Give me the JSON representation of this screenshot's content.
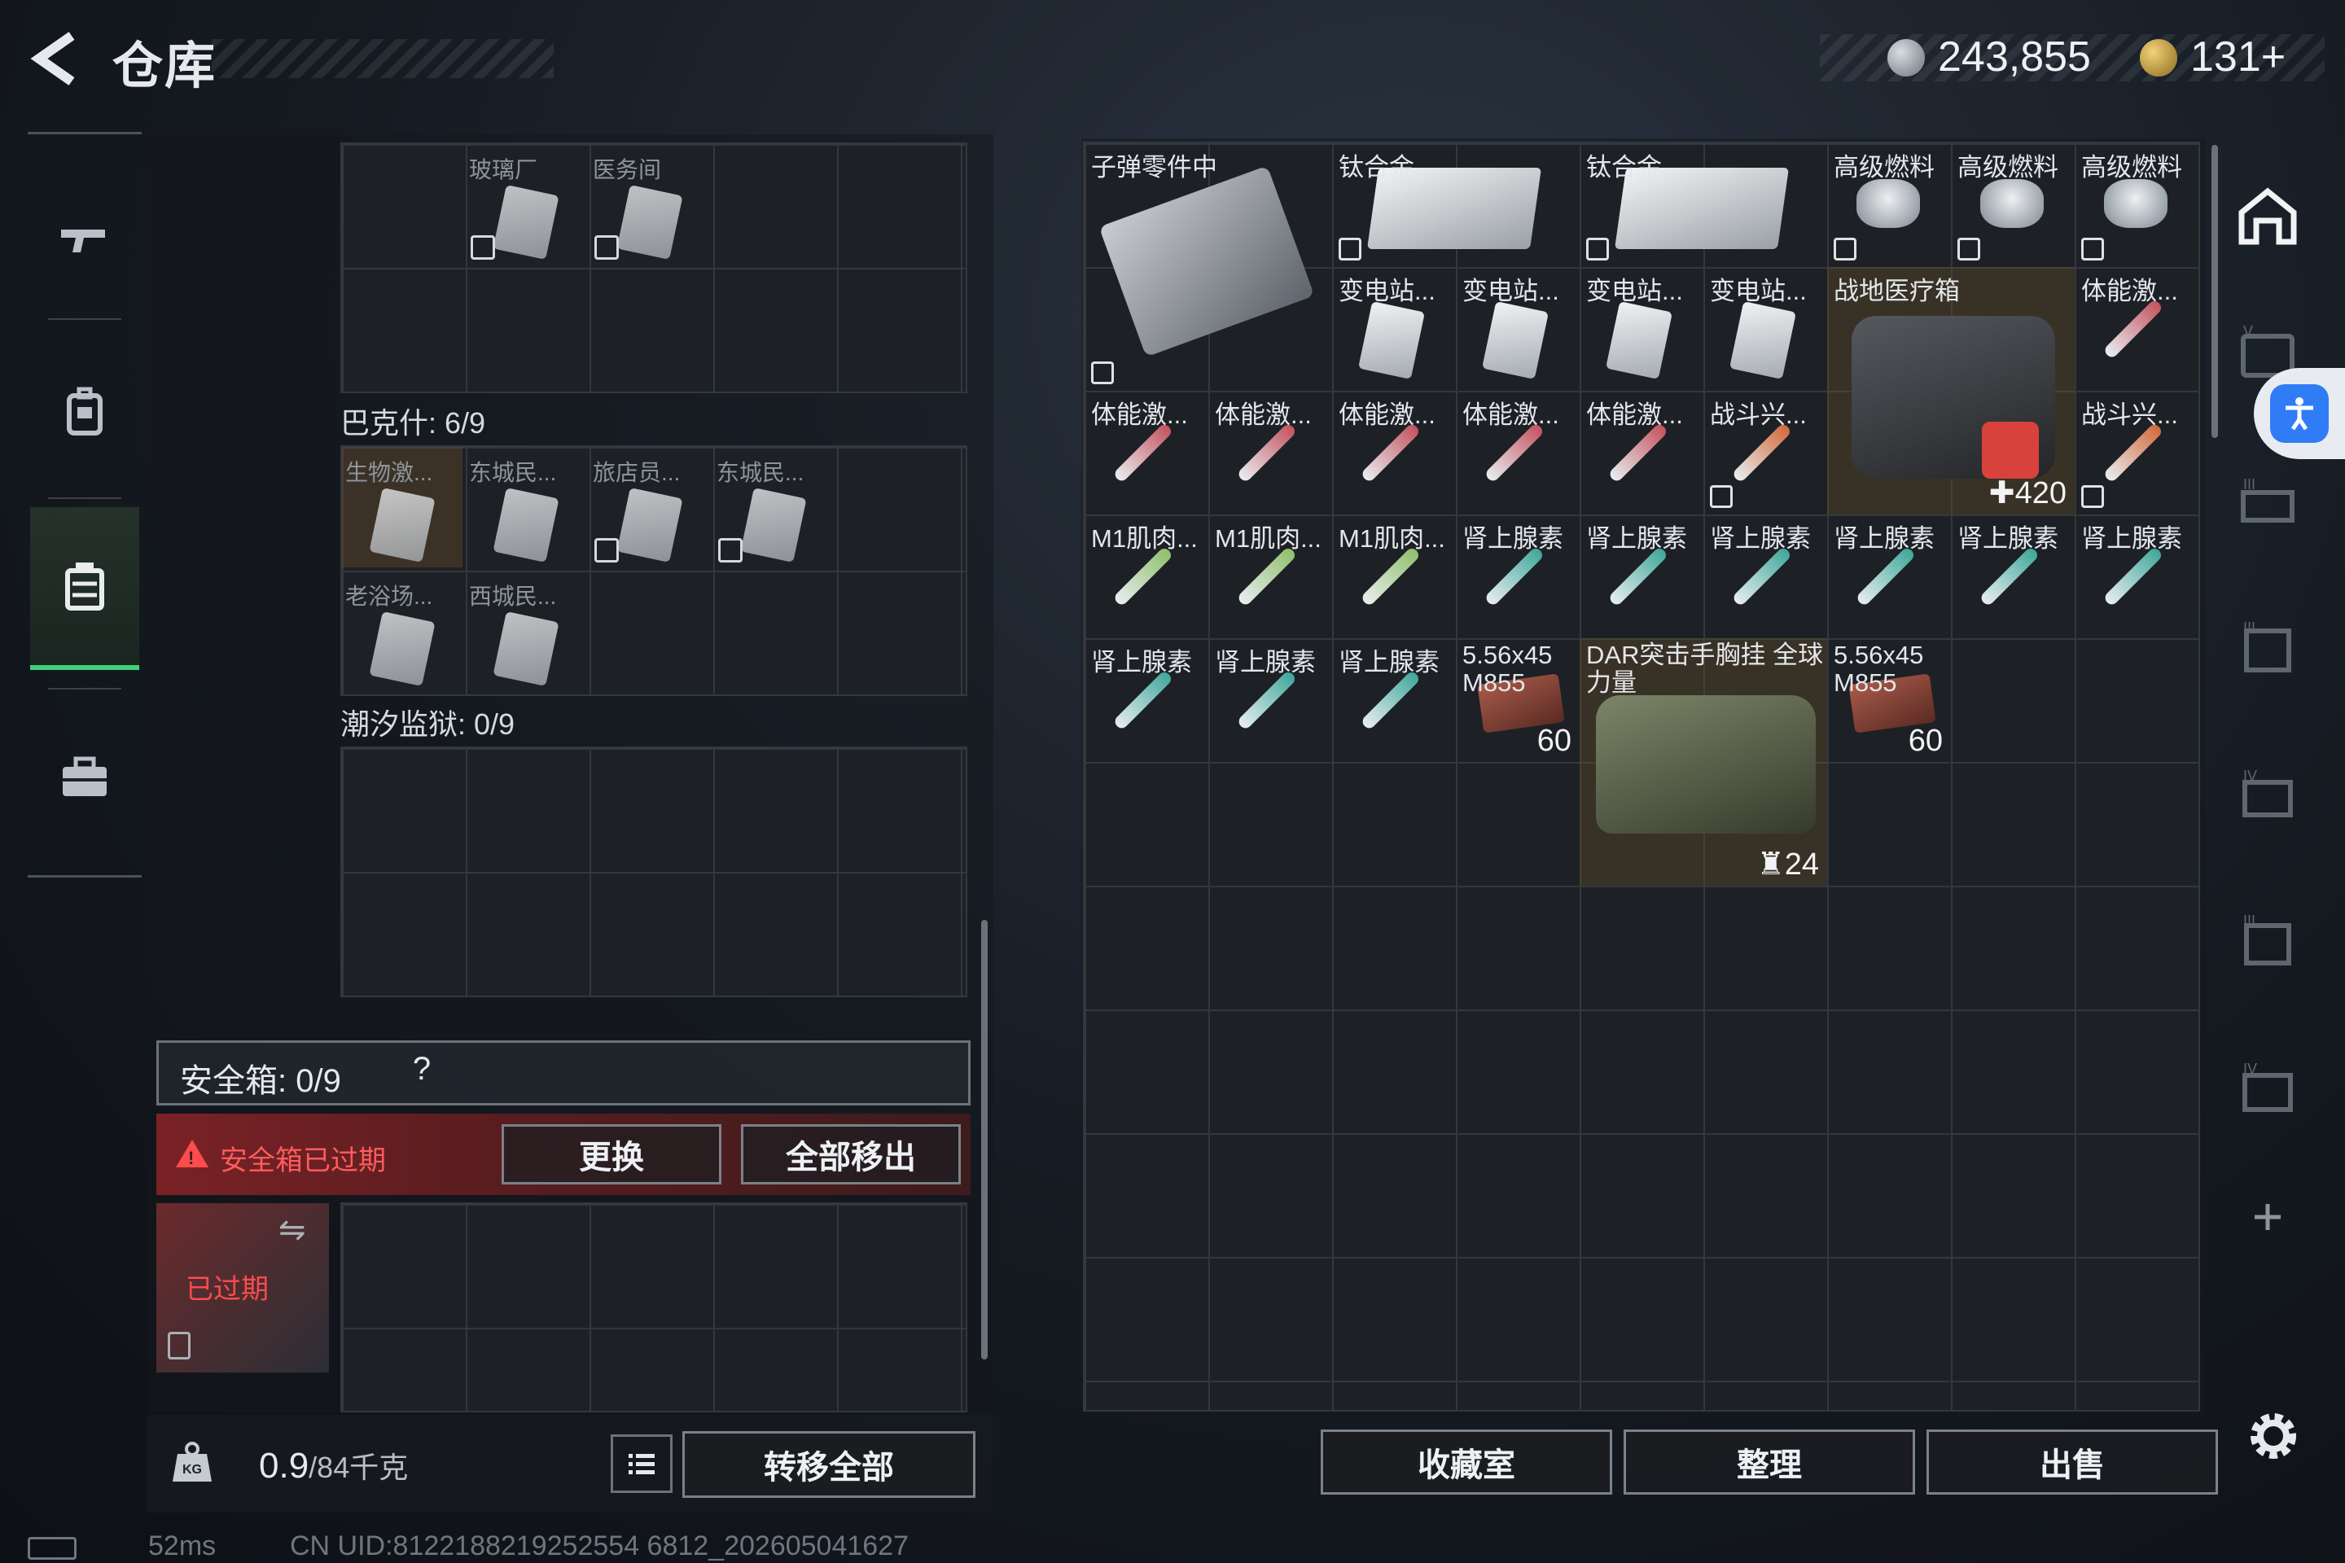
{
  "header": {
    "title": "仓库",
    "money": "243,855",
    "gems": "131+"
  },
  "leftnav": [
    "gun-icon",
    "backpack-icon",
    "storage-icon",
    "briefcase-icon"
  ],
  "storage": {
    "top_items": [
      "玻璃厂",
      "医务间"
    ],
    "bakshi_label": "巴克什: 6/9",
    "bakshi_items": [
      "生物激...",
      "东城民...",
      "旅店员...",
      "东城民...",
      "老浴场...",
      "西城民..."
    ],
    "tidal_label": "潮汐监狱: 0/9"
  },
  "safe": {
    "label": "安全箱: 0/9",
    "help": "?",
    "warning": "安全箱已过期",
    "replace_btn": "更换",
    "move_all_btn": "全部移出",
    "expired_label": "已过期"
  },
  "weight": {
    "current": "0.9",
    "max": "/84千克",
    "transfer_btn": "转移全部"
  },
  "inventory": {
    "items": [
      {
        "name": "子弹零件中",
        "kind": "bulletbox",
        "col": 0,
        "row": 0,
        "w": 2,
        "h": 2,
        "marked": true
      },
      {
        "name": "钛合金",
        "kind": "plate",
        "col": 2,
        "row": 0,
        "w": 2,
        "h": 1,
        "marked": true
      },
      {
        "name": "钛合金",
        "kind": "plate",
        "col": 4,
        "row": 0,
        "w": 2,
        "h": 1,
        "marked": true
      },
      {
        "name": "高级燃料",
        "kind": "can",
        "col": 6,
        "row": 0,
        "w": 1,
        "h": 1,
        "marked": true
      },
      {
        "name": "高级燃料",
        "kind": "can",
        "col": 7,
        "row": 0,
        "w": 1,
        "h": 1,
        "marked": true
      },
      {
        "name": "高级燃料",
        "kind": "can",
        "col": 8,
        "row": 0,
        "w": 1,
        "h": 1,
        "marked": true
      },
      {
        "name": "变电站...",
        "kind": "card",
        "col": 2,
        "row": 1,
        "w": 1,
        "h": 1
      },
      {
        "name": "变电站...",
        "kind": "card",
        "col": 3,
        "row": 1,
        "w": 1,
        "h": 1
      },
      {
        "name": "变电站...",
        "kind": "card",
        "col": 4,
        "row": 1,
        "w": 1,
        "h": 1
      },
      {
        "name": "变电站...",
        "kind": "card",
        "col": 5,
        "row": 1,
        "w": 1,
        "h": 1
      },
      {
        "name": "战地医疗箱",
        "kind": "medkit",
        "col": 6,
        "row": 1,
        "w": 2,
        "h": 2,
        "count": "✚420"
      },
      {
        "name": "体能激...",
        "kind": "syr-red",
        "col": 8,
        "row": 1,
        "w": 1,
        "h": 1
      },
      {
        "name": "体能激...",
        "kind": "syr-red",
        "col": 0,
        "row": 2,
        "w": 1,
        "h": 1
      },
      {
        "name": "体能激...",
        "kind": "syr-red",
        "col": 1,
        "row": 2,
        "w": 1,
        "h": 1
      },
      {
        "name": "体能激...",
        "kind": "syr-red",
        "col": 2,
        "row": 2,
        "w": 1,
        "h": 1
      },
      {
        "name": "体能激...",
        "kind": "syr-red",
        "col": 3,
        "row": 2,
        "w": 1,
        "h": 1
      },
      {
        "name": "体能激...",
        "kind": "syr-red",
        "col": 4,
        "row": 2,
        "w": 1,
        "h": 1
      },
      {
        "name": "战斗兴...",
        "kind": "syr-orange",
        "col": 5,
        "row": 2,
        "w": 1,
        "h": 1,
        "marked": true
      },
      {
        "name": "战斗兴...",
        "kind": "syr-orange",
        "col": 8,
        "row": 2,
        "w": 1,
        "h": 1,
        "marked": true
      },
      {
        "name": "M1肌肉...",
        "kind": "syr-green",
        "col": 0,
        "row": 3,
        "w": 1,
        "h": 1
      },
      {
        "name": "M1肌肉...",
        "kind": "syr-green",
        "col": 1,
        "row": 3,
        "w": 1,
        "h": 1
      },
      {
        "name": "M1肌肉...",
        "kind": "syr-green",
        "col": 2,
        "row": 3,
        "w": 1,
        "h": 1
      },
      {
        "name": "肾上腺素",
        "kind": "syr-teal",
        "col": 3,
        "row": 3,
        "w": 1,
        "h": 1
      },
      {
        "name": "肾上腺素",
        "kind": "syr-teal",
        "col": 4,
        "row": 3,
        "w": 1,
        "h": 1
      },
      {
        "name": "肾上腺素",
        "kind": "syr-teal",
        "col": 5,
        "row": 3,
        "w": 1,
        "h": 1
      },
      {
        "name": "肾上腺素",
        "kind": "syr-teal",
        "col": 6,
        "row": 3,
        "w": 1,
        "h": 1
      },
      {
        "name": "肾上腺素",
        "kind": "syr-teal",
        "col": 7,
        "row": 3,
        "w": 1,
        "h": 1
      },
      {
        "name": "肾上腺素",
        "kind": "syr-teal",
        "col": 8,
        "row": 3,
        "w": 1,
        "h": 1
      },
      {
        "name": "肾上腺素",
        "kind": "syr-teal",
        "col": 0,
        "row": 4,
        "w": 1,
        "h": 1
      },
      {
        "name": "肾上腺素",
        "kind": "syr-teal",
        "col": 1,
        "row": 4,
        "w": 1,
        "h": 1
      },
      {
        "name": "肾上腺素",
        "kind": "syr-teal",
        "col": 2,
        "row": 4,
        "w": 1,
        "h": 1
      },
      {
        "name": "5.56x45 M855",
        "kind": "ammo",
        "col": 3,
        "row": 4,
        "w": 1,
        "h": 1,
        "count": "60"
      },
      {
        "name": "DAR突击手胸挂 全球力量",
        "kind": "bag",
        "col": 4,
        "row": 4,
        "w": 2,
        "h": 2,
        "count": "♜24"
      },
      {
        "name": "5.56x45 M855",
        "kind": "ammo",
        "col": 6,
        "row": 4,
        "w": 1,
        "h": 1,
        "count": "60"
      }
    ]
  },
  "bottom_buttons": {
    "collection": "收藏室",
    "sort": "整理",
    "sell": "出售"
  },
  "status": {
    "ping": "52ms",
    "uid": "CN UID:8122188219252554 6812_202605041627"
  },
  "colors": {
    "accent": "#3fd17a",
    "warning": "#ff4b4b",
    "panel": "#1d2126"
  }
}
